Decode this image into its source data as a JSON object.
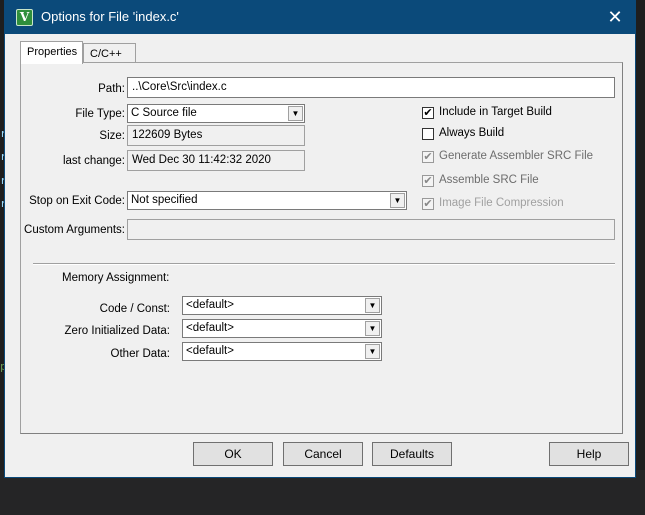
{
  "window": {
    "title": "Options for File 'index.c'",
    "icon": "keil-uvision-icon",
    "close_glyph": "✕"
  },
  "background": {
    "code_fragments": [
      "r",
      "r",
      "r",
      "r",
      "pi"
    ]
  },
  "tabs": [
    {
      "label": "Properties",
      "active": true
    },
    {
      "label": "C/C++",
      "active": false
    }
  ],
  "properties": {
    "path_label": "Path:",
    "path_value": "..\\Core\\Src\\index.c",
    "file_type_label": "File Type:",
    "file_type_value": "C Source file",
    "size_label": "Size:",
    "size_value": "122609 Bytes",
    "last_change_label": "last change:",
    "last_change_value": "Wed Dec 30 11:42:32 2020",
    "stop_label": "Stop on Exit Code:",
    "stop_value": "Not specified",
    "custom_args_label": "Custom Arguments:",
    "custom_args_value": ""
  },
  "options": [
    {
      "label": "Include in Target Build",
      "checked": true,
      "enabled": true
    },
    {
      "label": "Always Build",
      "checked": false,
      "enabled": true
    },
    {
      "label": "Generate Assembler SRC File",
      "checked": true,
      "enabled": false
    },
    {
      "label": "Assemble SRC File",
      "checked": true,
      "enabled": false
    },
    {
      "label": "Image File Compression",
      "checked": true,
      "enabled": false
    }
  ],
  "memory": {
    "heading": "Memory Assignment:",
    "code_label": "Code / Const:",
    "code_value": "<default>",
    "zero_label": "Zero Initialized Data:",
    "zero_value": "<default>",
    "other_label": "Other Data:",
    "other_value": "<default>"
  },
  "buttons": {
    "ok": "OK",
    "cancel": "Cancel",
    "defaults": "Defaults",
    "help": "Help"
  },
  "glyphs": {
    "dropdown_arrow": "▼",
    "check_mark": "✔"
  }
}
